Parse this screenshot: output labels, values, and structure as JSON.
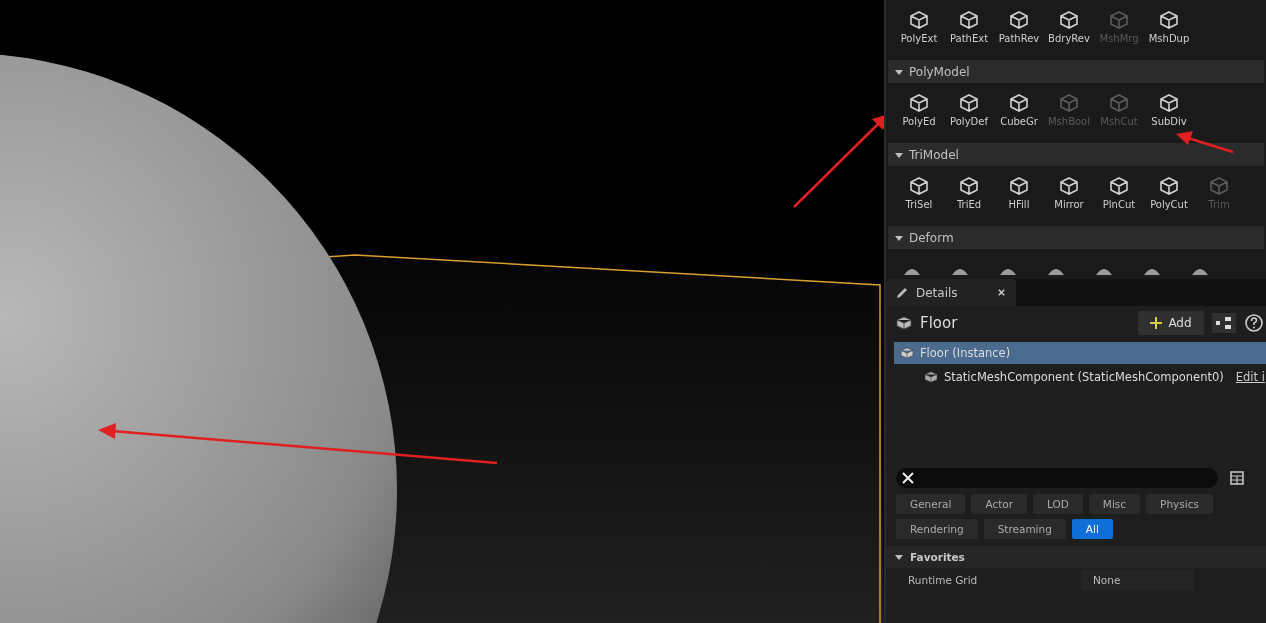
{
  "toolbar": {
    "top_tools": [
      {
        "label": "PolyExt",
        "disabled": false
      },
      {
        "label": "PathExt",
        "disabled": false
      },
      {
        "label": "PathRev",
        "disabled": false
      },
      {
        "label": "BdryRev",
        "disabled": false
      },
      {
        "label": "MshMrg",
        "disabled": true
      },
      {
        "label": "MshDup",
        "disabled": false
      }
    ],
    "sections": [
      {
        "title": "PolyModel",
        "expanded": true,
        "tools": [
          {
            "label": "PolyEd",
            "disabled": false
          },
          {
            "label": "PolyDef",
            "disabled": false
          },
          {
            "label": "CubeGr",
            "disabled": false
          },
          {
            "label": "MshBool",
            "disabled": true
          },
          {
            "label": "MshCut",
            "disabled": true
          },
          {
            "label": "SubDiv",
            "disabled": false
          }
        ]
      },
      {
        "title": "TriModel",
        "expanded": true,
        "tools": [
          {
            "label": "TriSel",
            "disabled": false
          },
          {
            "label": "TriEd",
            "disabled": false
          },
          {
            "label": "HFill",
            "disabled": false
          },
          {
            "label": "Mirror",
            "disabled": false
          },
          {
            "label": "PlnCut",
            "disabled": false
          },
          {
            "label": "PolyCut",
            "disabled": false
          },
          {
            "label": "Trim",
            "disabled": true
          }
        ]
      },
      {
        "title": "Deform",
        "expanded": true
      }
    ]
  },
  "details": {
    "tab": "Details",
    "actor": "Floor",
    "add_button": "Add",
    "tree": [
      {
        "label": "Floor (Instance)",
        "selected": true,
        "children": [
          {
            "label": "StaticMeshComponent (StaticMeshComponent0)",
            "selected": false,
            "link": "Edit i"
          }
        ]
      }
    ],
    "filters": [
      {
        "label": "General",
        "selected": false
      },
      {
        "label": "Actor",
        "selected": false
      },
      {
        "label": "LOD",
        "selected": false
      },
      {
        "label": "Misc",
        "selected": false
      },
      {
        "label": "Physics",
        "selected": false
      },
      {
        "label": "Rendering",
        "selected": false
      },
      {
        "label": "Streaming",
        "selected": false
      },
      {
        "label": "All",
        "selected": true
      }
    ],
    "category": {
      "title": "Favorites",
      "expanded": true
    },
    "properties": [
      {
        "name": "Runtime Grid",
        "value": "None"
      }
    ]
  }
}
